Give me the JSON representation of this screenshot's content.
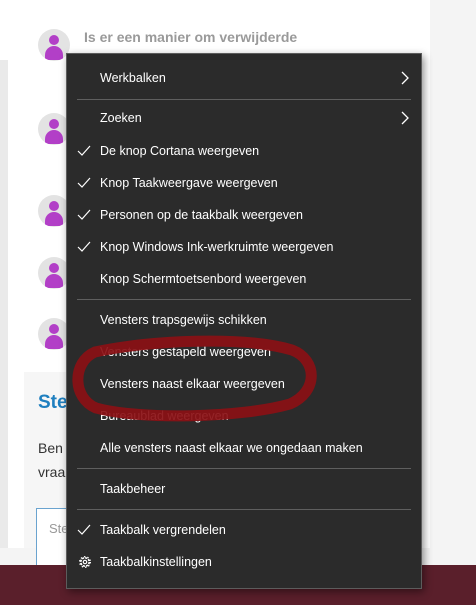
{
  "background": {
    "thread_title": "Is er een manier om verwijderde",
    "section_heading": "Ste",
    "text_line_1": "Ben",
    "text_line_2": "vraa",
    "editor_placeholder": "Ste"
  },
  "menu": {
    "items": [
      {
        "label": "Werkbalken",
        "checked": false,
        "submenu": true
      },
      {
        "label": "Zoeken",
        "checked": false,
        "submenu": true
      },
      {
        "label": "De knop Cortana weergeven",
        "checked": true
      },
      {
        "label": "Knop Taakweergave weergeven",
        "checked": true
      },
      {
        "label": "Personen op de taakbalk weergeven",
        "checked": true
      },
      {
        "label": "Knop Windows Ink-werkruimte weergeven",
        "checked": true
      },
      {
        "label": "Knop Schermtoetsenbord weergeven",
        "checked": false
      },
      {
        "label": "Vensters trapsgewijs schikken",
        "checked": false
      },
      {
        "label": "Vensters gestapeld weergeven",
        "checked": false
      },
      {
        "label": "Vensters naast elkaar weergeven",
        "checked": false,
        "highlighted": true
      },
      {
        "label": "Bureaublad weergeven",
        "checked": false
      },
      {
        "label": "Alle vensters naast elkaar we ongedaan maken",
        "checked": false
      },
      {
        "label": "Taakbeheer",
        "checked": false
      },
      {
        "label": "Taakbalk vergrendelen",
        "checked": true
      },
      {
        "label": "Taakbalkinstellingen",
        "checked": false,
        "icon": "gear-icon"
      }
    ]
  },
  "colors": {
    "menu_bg": "#2b2b2b",
    "highlight_ring": "#8b1015",
    "avatar_accent": "#b23fc7",
    "link_blue": "#1f7fbf"
  }
}
